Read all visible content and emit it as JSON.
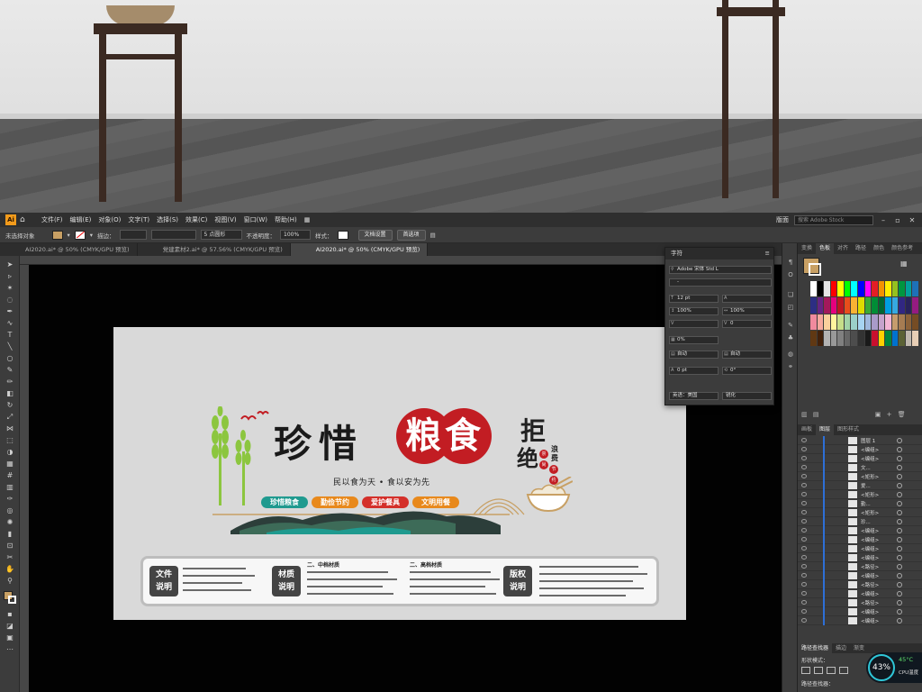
{
  "menubar": {
    "app_icon": "Ai",
    "menus": [
      "文件(F)",
      "编辑(E)",
      "对象(O)",
      "文字(T)",
      "选择(S)",
      "效果(C)",
      "视图(V)",
      "窗口(W)",
      "帮助(H)"
    ],
    "workspace": "版面",
    "stock_search_placeholder": "搜索 Adobe Stock"
  },
  "control_bar": {
    "selection": "未选择对象",
    "stroke_label": "描边：",
    "brush": "5 点圆形",
    "opacity_label": "不透明度：",
    "opacity": "100%",
    "style_label": "样式：",
    "doc_setup": "文档设置",
    "preferences": "首选项"
  },
  "tabs": [
    {
      "label": "AI2020.ai* @ 50% (CMYK/GPU 预览)",
      "active": false
    },
    {
      "label": "党建素材2.ai* @ 57.56% (CMYK/GPU 预览)",
      "active": false
    },
    {
      "label": "AI2020.ai* @ 50% (CMYK/GPU 预览)",
      "active": true
    }
  ],
  "artwork": {
    "title_chars": [
      "珍",
      "惜"
    ],
    "seal_chars": [
      "粮",
      "食"
    ],
    "subtitle": "民以食为天 • 食以安为先",
    "refuse": [
      "拒",
      "绝"
    ],
    "waste": "浪费",
    "red_dots": [
      "崇",
      "尚",
      "节",
      "约"
    ],
    "slogans": [
      {
        "text": "珍惜粮食",
        "color": "#1f9a8f"
      },
      {
        "text": "勤俭节约",
        "color": "#e8891c"
      },
      {
        "text": "爱护餐具",
        "color": "#d4302a"
      },
      {
        "text": "文明用餐",
        "color": "#e8891c"
      }
    ],
    "info": [
      {
        "label_1": "文件",
        "label_2": "说明",
        "heading": ""
      },
      {
        "label_1": "材质",
        "label_2": "说明",
        "heading": "二、中档材质"
      },
      {
        "label_1": "",
        "label_2": "",
        "heading": "二、高档材质"
      },
      {
        "label_1": "版权",
        "label_2": "说明",
        "heading": ""
      }
    ],
    "colors": {
      "wheat": "#8cc63f",
      "red": "#c21d23",
      "teal": "#1f9a8f",
      "mountain": "#2c3e3a"
    }
  },
  "char_panel": {
    "title": "字符",
    "font_family": "Adobe 宋体 Std L",
    "font_style": "-",
    "font_size": "12 pt",
    "leading": "",
    "scale_v": "100%",
    "scale_h": "100%",
    "kerning": "",
    "tracking": "0",
    "tsume": "0%",
    "aki_left": "自动",
    "aki_right": "自动",
    "baseline": "0 pt",
    "rotate": "0°",
    "language": "英语：美国",
    "anti_alias": "锐化"
  },
  "right_panel": {
    "top_tabs": [
      "变换",
      "色板",
      "对齐",
      "路径",
      "颜色",
      "颜色参考"
    ],
    "active_top_tab": "色板",
    "layer_tabs": [
      "画板",
      "图层",
      "图形样式"
    ],
    "active_layer_tab": "图层",
    "layers": [
      "图层 1",
      "<编组>",
      "<编组>",
      "文...",
      "<矩形>",
      "爱...",
      "<矩形>",
      "勤...",
      "<矩形>",
      "珍...",
      "<编组>",
      "<编组>",
      "<编组>",
      "<编组>",
      "<路径>",
      "<编组>",
      "<路径>",
      "<编组>",
      "<路径>",
      "<编组>",
      "<编组>"
    ],
    "pathfinder_tabs": [
      "路径查找器",
      "描边",
      "渐变"
    ],
    "shape_mode": "形状模式：",
    "pathfinder_label": "路径查找器："
  },
  "cpu": {
    "percent": "43%",
    "temp": "45°C",
    "label": "CPU温度"
  },
  "swatch_colors": [
    "#ffffff",
    "#000000",
    "#e5e5e5",
    "#ff0000",
    "#ffff00",
    "#00ff00",
    "#00ffff",
    "#0000ff",
    "#ff00ff",
    "#e31e24",
    "#f39200",
    "#ffed00",
    "#95c11f",
    "#009640",
    "#00a19a",
    "#1d71b8",
    "#2d2e83",
    "#662483",
    "#a3195b",
    "#e6007e",
    "#be1622",
    "#e94e1b",
    "#f9b233",
    "#dedc00",
    "#3aaa35",
    "#008d36",
    "#006633",
    "#009fe3",
    "#36a9e1",
    "#312783",
    "#29235c",
    "#951b81",
    "#f08a9e",
    "#f6a89e",
    "#fbd09c",
    "#fff59e",
    "#c6de89",
    "#a1d3a7",
    "#9bd0c9",
    "#a7d4f1",
    "#9fb8dd",
    "#a99bc9",
    "#c5a3cc",
    "#f2b5d4",
    "#c69c6d",
    "#a67c52",
    "#8c6239",
    "#754c24",
    "#603813",
    "#42210b",
    "#b3b3b3",
    "#999999",
    "#808080",
    "#666666",
    "#4d4d4d",
    "#333333",
    "#1a1a1a",
    "#c8102e",
    "#ffd100",
    "#00843d",
    "#0072ce",
    "#5b6236",
    "#bfb8af",
    "#e7ceb5"
  ]
}
